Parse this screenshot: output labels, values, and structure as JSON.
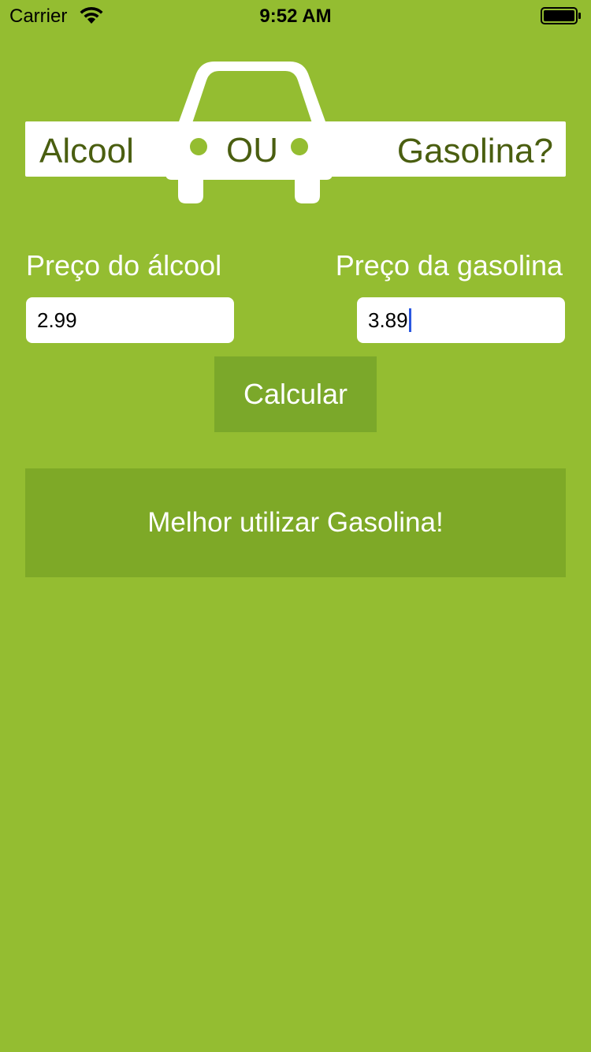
{
  "status_bar": {
    "carrier": "Carrier",
    "time": "9:52 AM",
    "wifi_icon": "wifi-icon",
    "battery_icon": "battery-full-icon"
  },
  "logo": {
    "left_text": "Alcool",
    "middle_text": "OU",
    "right_text": "Gasolina?",
    "text_color": "#4a5e10",
    "dot_color": "#94bd31"
  },
  "form": {
    "alcool_label": "Preço do álcool",
    "alcool_value": "2.99",
    "gasolina_label": "Preço da gasolina",
    "gasolina_value": "3.89"
  },
  "button": {
    "calculate_label": "Calcular"
  },
  "result": {
    "message": "Melhor utilizar Gasolina!"
  },
  "colors": {
    "background": "#94bd31",
    "button": "#7ba82a",
    "result_box": "#7ea927",
    "caret": "#2a57e0"
  }
}
